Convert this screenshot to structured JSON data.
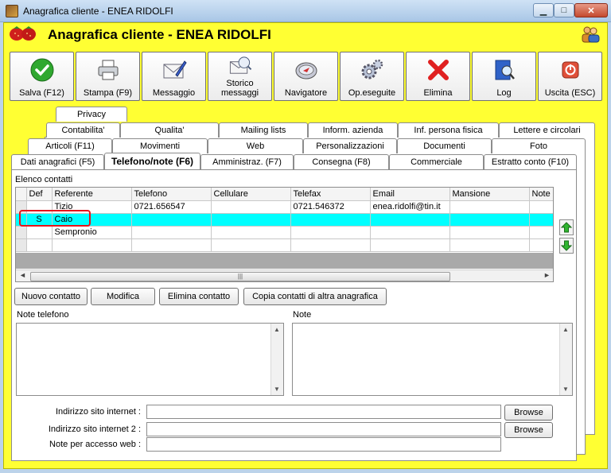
{
  "window": {
    "title": "Anagrafica cliente - ENEA RIDOLFI",
    "min": "▁",
    "max": "□",
    "close": "✕"
  },
  "header": {
    "title": "Anagrafica cliente - ENEA RIDOLFI"
  },
  "toolbar": [
    {
      "label": "Salva (F12)",
      "icon": "check-icon"
    },
    {
      "label": "Stampa (F9)",
      "icon": "printer-icon"
    },
    {
      "label": "Messaggio",
      "icon": "envelope-pen-icon"
    },
    {
      "label": "Storico messaggi",
      "icon": "message-history-icon"
    },
    {
      "label": "Navigatore",
      "icon": "compass-icon"
    },
    {
      "label": "Op.eseguite",
      "icon": "gears-icon"
    },
    {
      "label": "Elimina",
      "icon": "delete-x-icon"
    },
    {
      "label": "Log",
      "icon": "log-book-icon"
    },
    {
      "label": "Uscita (ESC)",
      "icon": "exit-icon"
    }
  ],
  "tabs": {
    "row1": [
      "Privacy"
    ],
    "row2": [
      "Contabilita'",
      "Qualita'",
      "Mailing lists",
      "Inform. azienda",
      "Inf. persona fisica",
      "Lettere e circolari"
    ],
    "row3": [
      "Articoli (F11)",
      "Movimenti",
      "Web",
      "Personalizzazioni",
      "Documenti",
      "Foto"
    ],
    "row4": [
      "Dati anagrafici (F5)",
      "Telefono/note (F6)",
      "Amministraz. (F7)",
      "Consegna (F8)",
      "Commerciale",
      "Estratto conto (F10)"
    ],
    "active": "Telefono/note (F6)"
  },
  "contacts": {
    "group_label": "Elenco contatti",
    "columns": [
      "Def",
      "Referente",
      "Telefono",
      "Cellulare",
      "Telefax",
      "Email",
      "Mansione",
      "Note"
    ],
    "rows": [
      {
        "def": "",
        "referente": "Tizio",
        "telefono": "0721.656547",
        "cellulare": "",
        "telefax": "0721.546372",
        "email": "enea.ridolfi@tin.it",
        "mansione": "",
        "note": ""
      },
      {
        "def": "S",
        "referente": "Caio",
        "telefono": "",
        "cellulare": "",
        "telefax": "",
        "email": "",
        "mansione": "",
        "note": ""
      },
      {
        "def": "",
        "referente": "Sempronio",
        "telefono": "",
        "cellulare": "",
        "telefax": "",
        "email": "",
        "mansione": "",
        "note": ""
      }
    ],
    "selected_row": 1,
    "scroll_thumb_glyph": "|||",
    "scroll_left": "◄",
    "scroll_right": "►"
  },
  "buttons": {
    "new_contact": "Nuovo contatto",
    "edit": "Modifica",
    "delete_contact": "Elimina contatto",
    "copy_contacts": "Copia contatti di altra anagrafica"
  },
  "notes": {
    "phone_notes_label": "Note telefono",
    "notes_label": "Note",
    "phone_notes_value": "",
    "notes_value": ""
  },
  "web": {
    "site1_label": "Indirizzo sito internet :",
    "site2_label": "Indirizzo sito internet 2 :",
    "access_label": "Note per accesso web :",
    "site1_value": "",
    "site2_value": "",
    "access_value": "",
    "browse_label": "Browse"
  }
}
